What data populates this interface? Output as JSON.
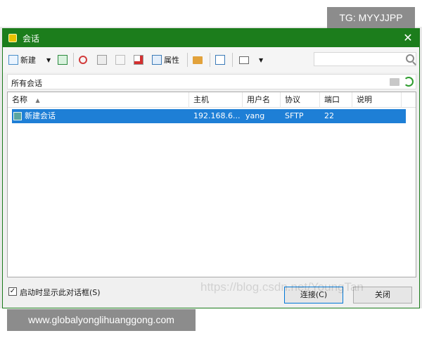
{
  "window": {
    "title": "会话",
    "close_glyph": "✕"
  },
  "toolbar": {
    "new_label": "新建",
    "properties_label": "属性",
    "search_placeholder": ""
  },
  "path": {
    "label": "所有会话"
  },
  "table": {
    "columns": [
      "名称",
      "主机",
      "用户名",
      "协议",
      "端口",
      "说明"
    ],
    "sort_indicator": "▲",
    "rows": [
      {
        "name": "新建会话",
        "host": "192.168.6...",
        "user": "yang",
        "protocol": "SFTP",
        "port": "22",
        "desc": ""
      }
    ]
  },
  "footer": {
    "startup_checkbox_label": "启动时显示此对话框(S)",
    "startup_checked": true,
    "connect_label": "连接(C)",
    "close_label": "关闭"
  },
  "overlay": {
    "tg": "TG: MYYJJPP",
    "site": "www.globalyonglihuanggong.com",
    "watermark": "https://blog.csdn.net/YoungTan"
  },
  "colors": {
    "titlebar": "#1c7d1c",
    "selection": "#1e7fd6"
  }
}
